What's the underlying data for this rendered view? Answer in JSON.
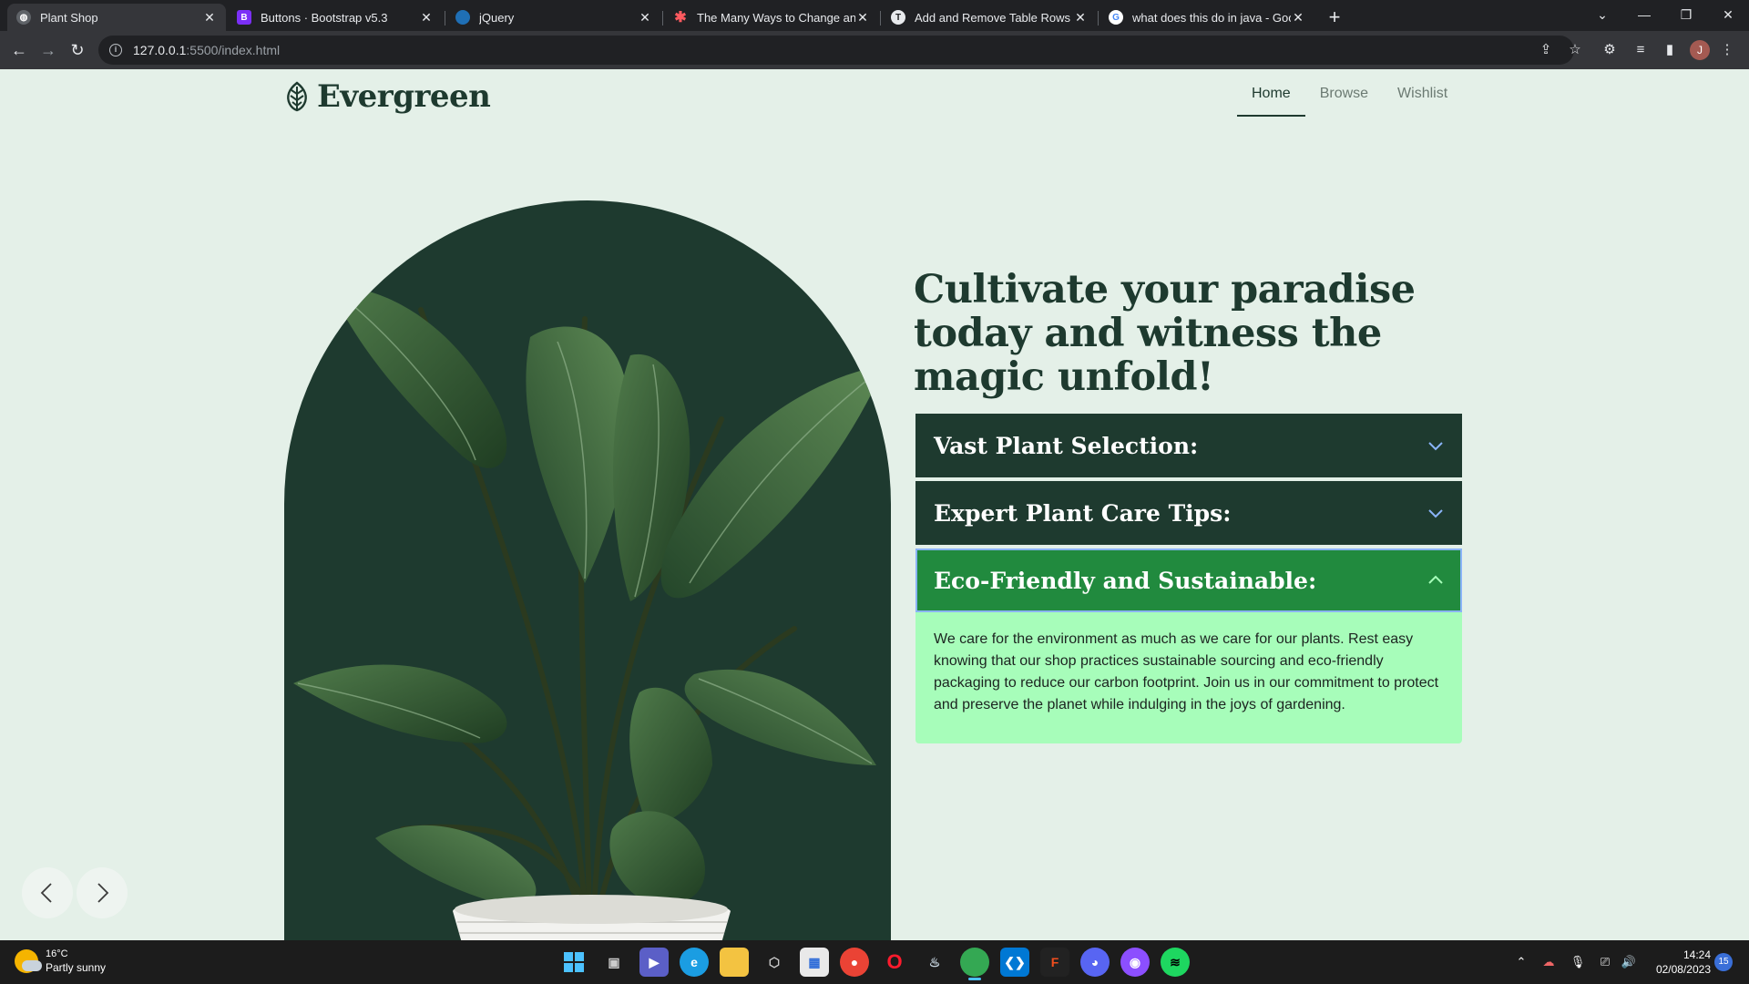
{
  "browser": {
    "tabs": [
      {
        "title": "Plant Shop",
        "active": true
      },
      {
        "title": "Buttons · Bootstrap v5.3",
        "active": false
      },
      {
        "title": "jQuery",
        "active": false
      },
      {
        "title": "The Many Ways to Change an SV",
        "active": false
      },
      {
        "title": "Add and Remove Table Rows Dy",
        "active": false
      },
      {
        "title": "what does this do in java - Goog",
        "active": false
      }
    ],
    "url_host": "127.0.0.1",
    "url_rest": ":5500/index.html",
    "profile_initial": "J"
  },
  "site": {
    "brand": "Evergreen",
    "nav": [
      {
        "label": "Home",
        "active": true
      },
      {
        "label": "Browse",
        "active": false
      },
      {
        "label": "Wishlist",
        "active": false
      }
    ],
    "headline": "Cultivate your paradise today and witness the magic unfold!",
    "accordion": [
      {
        "title": "Vast Plant Selection:",
        "open": false
      },
      {
        "title": "Expert Plant Care Tips:",
        "open": false
      },
      {
        "title": "Eco-Friendly and Sustainable:",
        "open": true,
        "body": "We care for the environment as much as we care for our plants. Rest easy knowing that our shop practices sustainable sourcing and eco-friendly packaging to reduce our carbon footprint. Join us in our commitment to protect and preserve the planet while indulging in the joys of gardening."
      }
    ],
    "colors": {
      "dark_green": "#1e3a2f",
      "active_green": "#218a3e",
      "light_green_panel": "#a7fdba",
      "page_bg": "#e4f0e8"
    }
  },
  "taskbar": {
    "weather_temp": "16°C",
    "weather_desc": "Partly sunny",
    "time": "14:24",
    "date": "02/08/2023",
    "notifications": "15"
  }
}
